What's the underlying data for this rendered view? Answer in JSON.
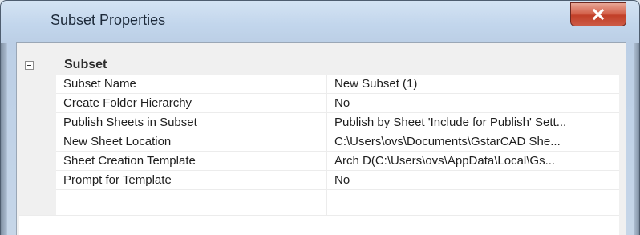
{
  "window": {
    "title": "Subset Properties",
    "close_icon": "close-icon"
  },
  "category": {
    "label": "Subset",
    "expander_icon": "collapse-minus-icon"
  },
  "properties": [
    {
      "name": "Subset Name",
      "value": "New Subset (1)"
    },
    {
      "name": "Create Folder Hierarchy",
      "value": "No"
    },
    {
      "name": "Publish Sheets in Subset",
      "value": "Publish by Sheet 'Include for Publish' Sett..."
    },
    {
      "name": "New Sheet Location",
      "value": "C:\\Users\\ovs\\Documents\\GstarCAD She..."
    },
    {
      "name": "Sheet Creation Template",
      "value": "Arch D(C:\\Users\\ovs\\AppData\\Local\\Gs..."
    },
    {
      "name": "Prompt for Template",
      "value": "No"
    }
  ],
  "colors": {
    "close_button": "#c13f28",
    "title_bar": "#c2d6ec",
    "grid_background": "#ffffff",
    "gutter": "#f0f0f0"
  }
}
